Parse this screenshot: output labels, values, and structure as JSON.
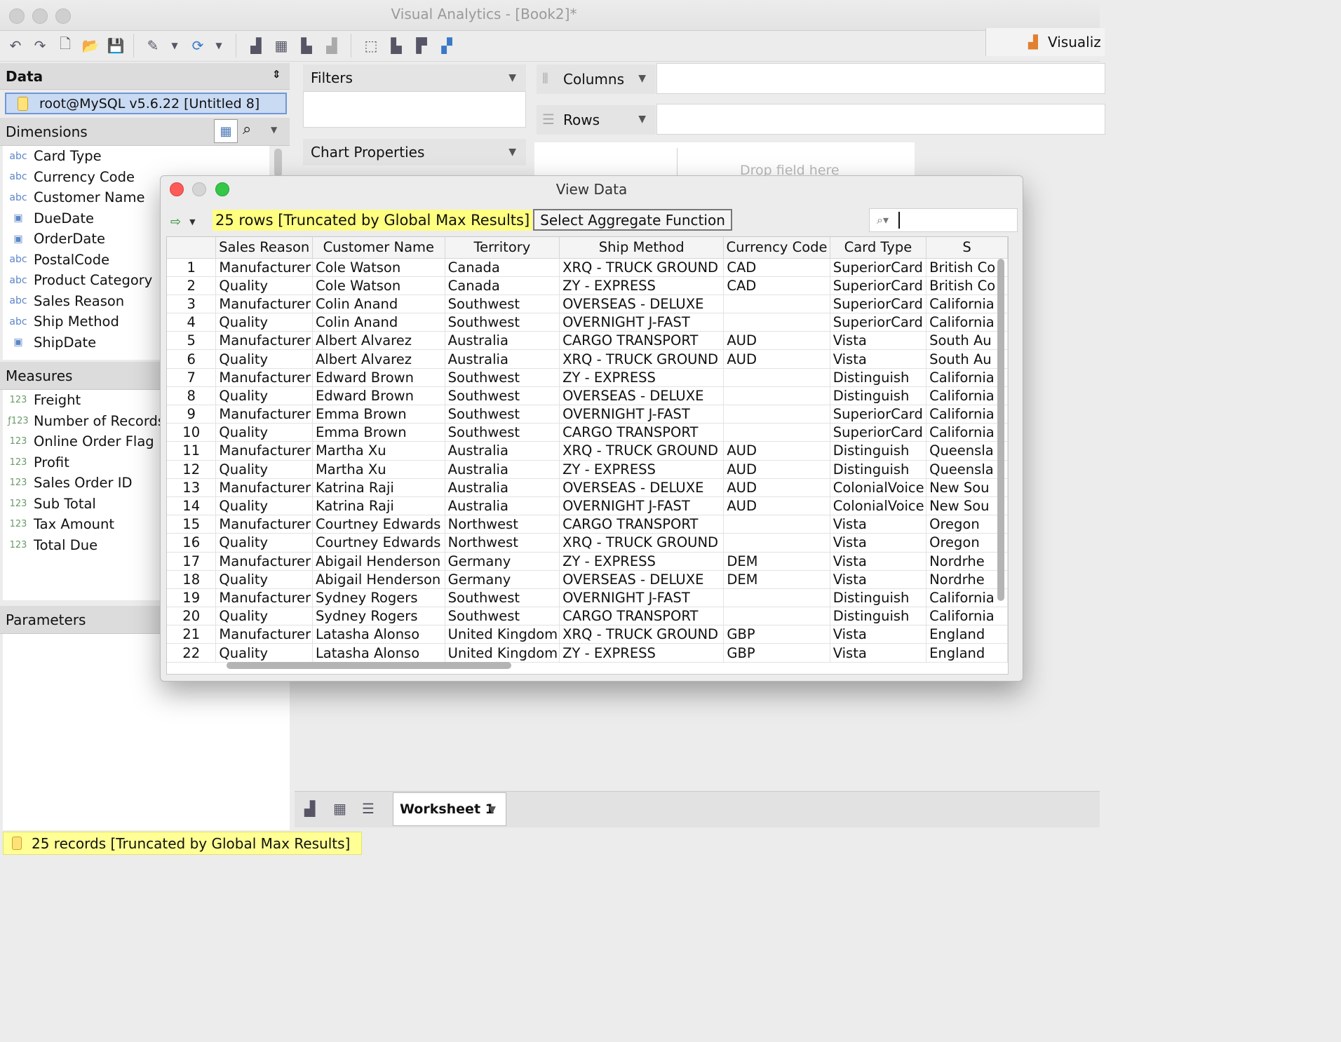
{
  "window": {
    "title": "Visual Analytics - [Book2]*"
  },
  "right_tab": {
    "label": "Visualiz"
  },
  "toolbar": {
    "icons": [
      "undo-icon",
      "redo-icon",
      "new-icon",
      "open-icon",
      "save-icon",
      "paint-icon",
      "refresh-icon",
      "add-chart-icon",
      "add-dashboard-icon",
      "delete-chart-icon",
      "chart-icon",
      "select-icon",
      "align-left-icon",
      "align-top-icon",
      "layout-icon"
    ]
  },
  "data_panel": {
    "title": "Data",
    "connection": "root@MySQL v5.6.22 [Untitled 8]",
    "dimensions_title": "Dimensions",
    "dimensions": [
      {
        "type": "abc",
        "label": "Card Type"
      },
      {
        "type": "abc",
        "label": "Currency Code"
      },
      {
        "type": "abc",
        "label": "Customer Name"
      },
      {
        "type": "date",
        "label": "DueDate"
      },
      {
        "type": "date",
        "label": "OrderDate"
      },
      {
        "type": "abc",
        "label": "PostalCode"
      },
      {
        "type": "abc",
        "label": "Product Category"
      },
      {
        "type": "abc",
        "label": "Sales Reason"
      },
      {
        "type": "abc",
        "label": "Ship Method"
      },
      {
        "type": "date",
        "label": "ShipDate"
      }
    ],
    "measures_title": "Measures",
    "measures": [
      {
        "type": "123",
        "label": "Freight"
      },
      {
        "type": "f123",
        "label": "Number of Records"
      },
      {
        "type": "123",
        "label": "Online Order Flag"
      },
      {
        "type": "123",
        "label": "Profit"
      },
      {
        "type": "123",
        "label": "Sales Order ID"
      },
      {
        "type": "123",
        "label": "Sub Total"
      },
      {
        "type": "123",
        "label": "Tax Amount"
      },
      {
        "type": "123",
        "label": "Total Due"
      }
    ],
    "parameters_title": "Parameters"
  },
  "status": {
    "text": "25 records [Truncated by Global Max Results]"
  },
  "filters": {
    "title": "Filters"
  },
  "chart_properties": {
    "title": "Chart Properties"
  },
  "shelves": {
    "columns": "Columns",
    "rows": "Rows"
  },
  "canvas": {
    "drop_hint": "Drop field here"
  },
  "worksheet": {
    "tab": "Worksheet 1"
  },
  "dialog": {
    "title": "View Data",
    "row_count": "25 rows [Truncated by Global Max Results]",
    "aggregate_button": "Select Aggregate Function",
    "columns": [
      "",
      "Sales Reason",
      "Customer Name",
      "Territory",
      "Ship Method",
      "Currency Code",
      "Card Type",
      "S"
    ],
    "rows": [
      [
        "1",
        "Manufacturer",
        "Cole Watson",
        "Canada",
        "XRQ - TRUCK GROUND",
        "CAD",
        "SuperiorCard",
        "British Co"
      ],
      [
        "2",
        "Quality",
        "Cole Watson",
        "Canada",
        "ZY - EXPRESS",
        "CAD",
        "SuperiorCard",
        "British Co"
      ],
      [
        "3",
        "Manufacturer",
        "Colin Anand",
        "Southwest",
        "OVERSEAS - DELUXE",
        "",
        "SuperiorCard",
        "California"
      ],
      [
        "4",
        "Quality",
        "Colin Anand",
        "Southwest",
        "OVERNIGHT J-FAST",
        "",
        "SuperiorCard",
        "California"
      ],
      [
        "5",
        "Manufacturer",
        "Albert Alvarez",
        "Australia",
        "CARGO TRANSPORT",
        "AUD",
        "Vista",
        "South Au"
      ],
      [
        "6",
        "Quality",
        "Albert Alvarez",
        "Australia",
        "XRQ - TRUCK GROUND",
        "AUD",
        "Vista",
        "South Au"
      ],
      [
        "7",
        "Manufacturer",
        "Edward Brown",
        "Southwest",
        "ZY - EXPRESS",
        "",
        "Distinguish",
        "California"
      ],
      [
        "8",
        "Quality",
        "Edward Brown",
        "Southwest",
        "OVERSEAS - DELUXE",
        "",
        "Distinguish",
        "California"
      ],
      [
        "9",
        "Manufacturer",
        "Emma Brown",
        "Southwest",
        "OVERNIGHT J-FAST",
        "",
        "SuperiorCard",
        "California"
      ],
      [
        "10",
        "Quality",
        "Emma Brown",
        "Southwest",
        "CARGO TRANSPORT",
        "",
        "SuperiorCard",
        "California"
      ],
      [
        "11",
        "Manufacturer",
        "Martha Xu",
        "Australia",
        "XRQ - TRUCK GROUND",
        "AUD",
        "Distinguish",
        "Queensla"
      ],
      [
        "12",
        "Quality",
        "Martha Xu",
        "Australia",
        "ZY - EXPRESS",
        "AUD",
        "Distinguish",
        "Queensla"
      ],
      [
        "13",
        "Manufacturer",
        "Katrina Raji",
        "Australia",
        "OVERSEAS - DELUXE",
        "AUD",
        "ColonialVoice",
        "New Sou"
      ],
      [
        "14",
        "Quality",
        "Katrina Raji",
        "Australia",
        "OVERNIGHT J-FAST",
        "AUD",
        "ColonialVoice",
        "New Sou"
      ],
      [
        "15",
        "Manufacturer",
        "Courtney Edwards",
        "Northwest",
        "CARGO TRANSPORT",
        "",
        "Vista",
        "Oregon"
      ],
      [
        "16",
        "Quality",
        "Courtney Edwards",
        "Northwest",
        "XRQ - TRUCK GROUND",
        "",
        "Vista",
        "Oregon"
      ],
      [
        "17",
        "Manufacturer",
        "Abigail Henderson",
        "Germany",
        "ZY - EXPRESS",
        "DEM",
        "Vista",
        "Nordrhe"
      ],
      [
        "18",
        "Quality",
        "Abigail Henderson",
        "Germany",
        "OVERSEAS - DELUXE",
        "DEM",
        "Vista",
        "Nordrhe"
      ],
      [
        "19",
        "Manufacturer",
        "Sydney Rogers",
        "Southwest",
        "OVERNIGHT J-FAST",
        "",
        "Distinguish",
        "California"
      ],
      [
        "20",
        "Quality",
        "Sydney Rogers",
        "Southwest",
        "CARGO TRANSPORT",
        "",
        "Distinguish",
        "California"
      ],
      [
        "21",
        "Manufacturer",
        "Latasha Alonso",
        "United Kingdom",
        "XRQ - TRUCK GROUND",
        "GBP",
        "Vista",
        "England"
      ],
      [
        "22",
        "Quality",
        "Latasha Alonso",
        "United Kingdom",
        "ZY - EXPRESS",
        "GBP",
        "Vista",
        "England"
      ]
    ]
  }
}
